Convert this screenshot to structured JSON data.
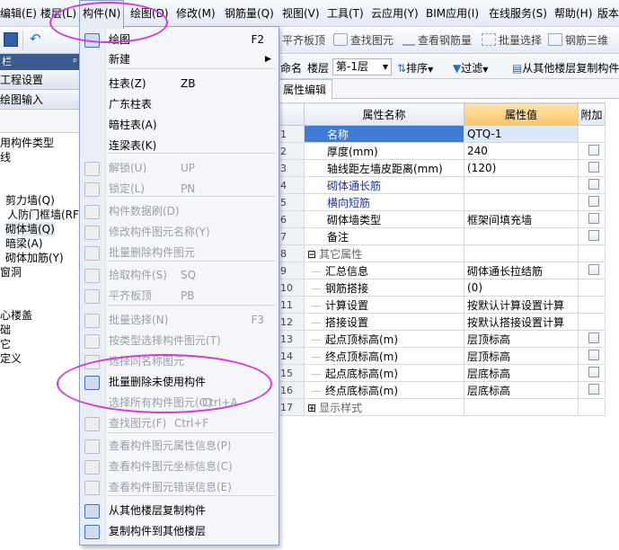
{
  "menubar": {
    "items": [
      "编辑(E)",
      "楼层(L)",
      "构件(N)",
      "绘图(D)",
      "修改(M)",
      "钢筋量(Q)",
      "视图(V)",
      "工具(T)",
      "云应用(Y)",
      "BIM应用(I)",
      "在线服务(S)",
      "帮助(H)",
      "版本"
    ]
  },
  "toolbar": {
    "items": [
      "平齐板顶",
      "查找图元",
      "查看钢筋量",
      "批量选择",
      "钢筋三维"
    ]
  },
  "leftpanel": {
    "title": "栏",
    "pin": "ᵖ",
    "tabs": [
      "工程设置",
      "绘图输入"
    ],
    "tree": [
      "用构件类型",
      "线",
      "剪力墙(Q)",
      "人防门框墙(RF",
      "砌体墙(Q)",
      "暗梁(A)",
      "砌体加筋(Y)",
      "窗洞",
      "心楼盖",
      "础",
      "它",
      "定义"
    ]
  },
  "gridbar": {
    "name_label": "命名",
    "floor_label": "楼层",
    "floor_value": "第-1层",
    "sort_label": "排序",
    "filter_label": "过滤",
    "copy_label": "从其他楼层复制构件"
  },
  "tabhdr": {
    "label": "属性编辑"
  },
  "grid": {
    "headers": {
      "name": "属性名称",
      "value": "属性值",
      "extra": "附加"
    },
    "rows": [
      {
        "no": "1",
        "name": "名称",
        "value": "QTQ-1",
        "check": false,
        "style": "blue"
      },
      {
        "no": "2",
        "name": "厚度(mm)",
        "value": "240",
        "check": true,
        "style": ""
      },
      {
        "no": "3",
        "name": "轴线距左墙皮距离(mm)",
        "value": "(120)",
        "check": true,
        "style": ""
      },
      {
        "no": "4",
        "name": "砌体通长筋",
        "value": "",
        "check": true,
        "style": "blue"
      },
      {
        "no": "5",
        "name": "横向短筋",
        "value": "",
        "check": true,
        "style": "blue"
      },
      {
        "no": "6",
        "name": "砌体墙类型",
        "value": "框架间填充墙",
        "check": true,
        "style": ""
      },
      {
        "no": "7",
        "name": "备注",
        "value": "",
        "check": true,
        "style": ""
      },
      {
        "no": "8",
        "name": "其它属性",
        "value": "",
        "check": false,
        "style": "group"
      },
      {
        "no": "9",
        "name": "汇总信息",
        "value": "砌体通长拉结筋",
        "check": true,
        "style": "sub"
      },
      {
        "no": "10",
        "name": "钢筋搭接",
        "value": "(0)",
        "check": false,
        "style": "sub"
      },
      {
        "no": "11",
        "name": "计算设置",
        "value": "按默认计算设置计算",
        "check": false,
        "style": "sub"
      },
      {
        "no": "12",
        "name": "搭接设置",
        "value": "按默认搭接设置计算",
        "check": false,
        "style": "sub"
      },
      {
        "no": "13",
        "name": "起点顶标高(m)",
        "value": "层顶标高",
        "check": true,
        "style": "sub"
      },
      {
        "no": "14",
        "name": "终点顶标高(m)",
        "value": "层顶标高",
        "check": true,
        "style": "sub"
      },
      {
        "no": "15",
        "name": "起点底标高(m)",
        "value": "层底标高",
        "check": true,
        "style": "sub"
      },
      {
        "no": "16",
        "name": "终点底标高(m)",
        "value": "层底标高",
        "check": true,
        "style": "sub"
      },
      {
        "no": "17",
        "name": "显示样式",
        "value": "",
        "check": false,
        "style": "group"
      }
    ]
  },
  "dropdown": {
    "items": [
      {
        "label": "绘图",
        "shortcut": "F2",
        "enabled": true,
        "icon": "draw-icon"
      },
      {
        "label": "新建",
        "shortcut": "",
        "enabled": true,
        "icon": "",
        "submenu": true
      },
      {
        "label": "柱表(Z)",
        "shortcut": "ZB",
        "enabled": true,
        "icon": ""
      },
      {
        "label": "广东柱表",
        "shortcut": "",
        "enabled": true,
        "icon": ""
      },
      {
        "label": "暗柱表(A)",
        "shortcut": "",
        "enabled": true,
        "icon": ""
      },
      {
        "label": "连梁表(K)",
        "shortcut": "",
        "enabled": true,
        "icon": ""
      },
      {
        "label": "解锁(U)",
        "shortcut": "UP",
        "enabled": false,
        "icon": "unlock-icon"
      },
      {
        "label": "锁定(L)",
        "shortcut": "PN",
        "enabled": false,
        "icon": "lock-icon"
      },
      {
        "label": "构件数据刷(D)",
        "shortcut": "",
        "enabled": false,
        "icon": "brush-icon"
      },
      {
        "label": "修改构件图元名称(Y)",
        "shortcut": "",
        "enabled": false,
        "icon": "rename-icon"
      },
      {
        "label": "批量删除构件图元",
        "shortcut": "",
        "enabled": false,
        "icon": "batch-delete-icon"
      },
      {
        "label": "拾取构件(S)",
        "shortcut": "SQ",
        "enabled": false,
        "icon": "pick-icon"
      },
      {
        "label": "平齐板顶",
        "shortcut": "PB",
        "enabled": false,
        "icon": "align-icon"
      },
      {
        "label": "批量选择(N)",
        "shortcut": "F3",
        "enabled": false,
        "icon": "batch-select-icon"
      },
      {
        "label": "按类型选择构件图元(T)",
        "shortcut": "",
        "enabled": false,
        "icon": "type-select-icon"
      },
      {
        "label": "选择同名称图元",
        "shortcut": "",
        "enabled": false,
        "icon": "same-name-icon"
      },
      {
        "label": "批量删除未使用构件",
        "shortcut": "",
        "enabled": true,
        "icon": "delete-unused-icon"
      },
      {
        "label": "选择所有构件图元(O)",
        "shortcut": "Ctrl+A",
        "enabled": false,
        "icon": ""
      },
      {
        "label": "查找图元(F)",
        "shortcut": "Ctrl+F",
        "enabled": false,
        "icon": "find-icon"
      },
      {
        "label": "查看构件图元属性信息(P)",
        "shortcut": "",
        "enabled": false,
        "icon": "prop-info-icon"
      },
      {
        "label": "查看构件图元坐标信息(C)",
        "shortcut": "",
        "enabled": false,
        "icon": "coord-info-icon"
      },
      {
        "label": "查看构件图元错误信息(E)",
        "shortcut": "",
        "enabled": false,
        "icon": "error-info-icon"
      },
      {
        "label": "从其他楼层复制构件",
        "shortcut": "",
        "enabled": true,
        "icon": "copy-from-floor-icon"
      },
      {
        "label": "复制构件到其他楼层",
        "shortcut": "",
        "enabled": true,
        "icon": "copy-to-floor-icon"
      }
    ]
  },
  "colors": {
    "accent": "#d63ad8",
    "highlight_header": "#fbd48a",
    "selected_row": "#3d7bd4",
    "link_blue": "#1c34a8"
  }
}
